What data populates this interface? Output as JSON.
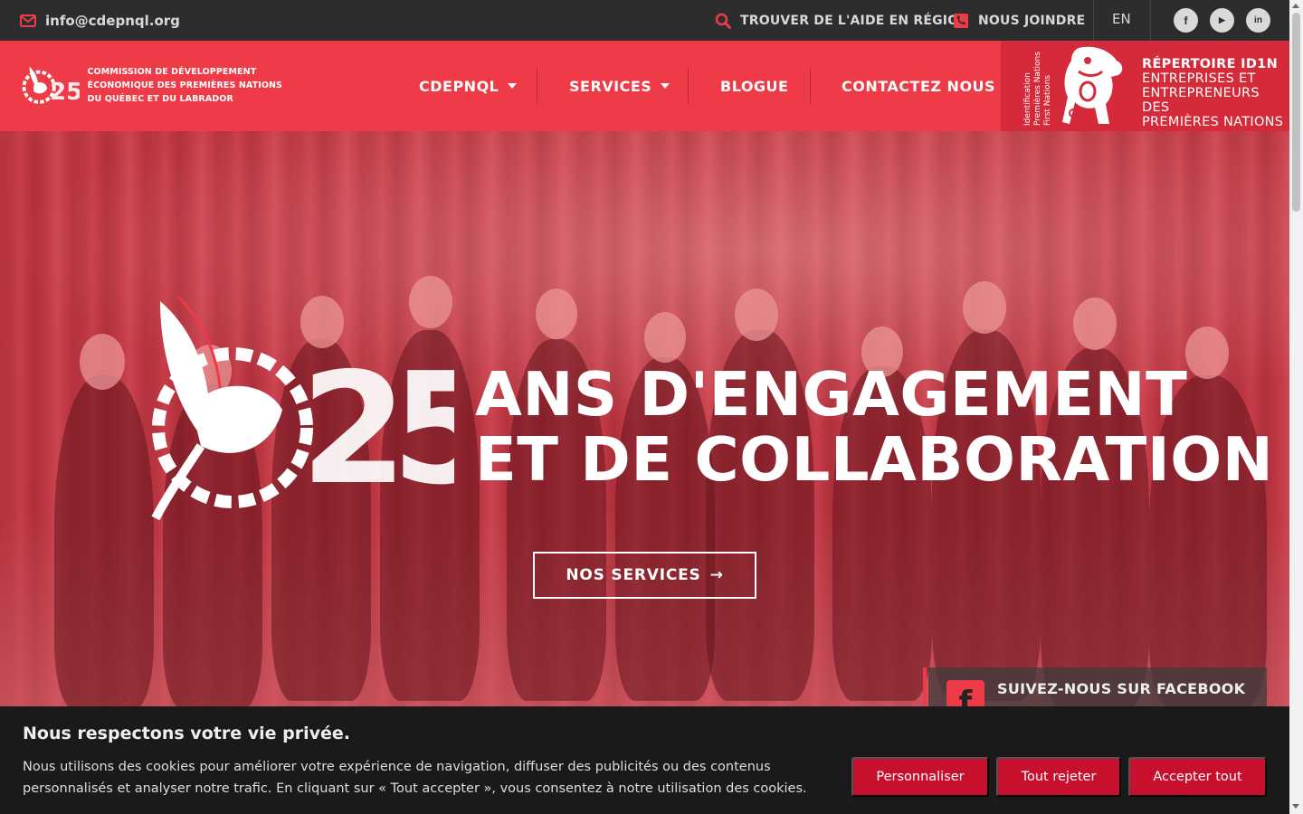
{
  "topbar": {
    "email": "info@cdepnql.org",
    "help_link": "TROUVER DE L'AIDE EN RÉGION",
    "join_link": "NOUS JOINDRE",
    "language": "EN",
    "social": [
      {
        "icon": "facebook-icon",
        "glyph": "f"
      },
      {
        "icon": "youtube-icon",
        "glyph": "▶"
      },
      {
        "icon": "linkedin-icon",
        "glyph": "in"
      }
    ]
  },
  "header": {
    "logo_lines": [
      "COMMISSION DE DÉVELOPPEMENT",
      "ÉCONOMIQUE DES PREMIÈRES NATIONS",
      "DU QUÉBEC ET DU LABRADOR"
    ],
    "nav": [
      {
        "label": "CDEPNQL",
        "dropdown": true
      },
      {
        "label": "SERVICES",
        "dropdown": true
      },
      {
        "label": "BLOGUE",
        "dropdown": false
      },
      {
        "label": "CONTACTEZ NOUS",
        "dropdown": false
      }
    ],
    "id1n": {
      "vertical_lines": [
        "Identification",
        "Premières Nations",
        "First Nations"
      ],
      "title": "RÉPERTOIRE ID1N",
      "subtitle_lines": [
        "ENTREPRISES ET",
        "ENTREPRENEURS DES",
        "PREMIÈRES NATIONS"
      ]
    }
  },
  "hero": {
    "headline_line1": "ANS D'ENGAGEMENT",
    "headline_line2": "ET DE COLLABORATION",
    "anniversary_number": "25",
    "cta_label": "NOS SERVICES",
    "facebook_label": "SUIVEZ-NOUS SUR FACEBOOK"
  },
  "cookie": {
    "title": "Nous respectons votre vie privée.",
    "text": "Nous utilisons des cookies pour améliorer votre expérience de navigation, diffuser des publicités ou des contenus personnalisés et analyser notre trafic. En cliquant sur « Tout accepter », vous consentez à notre utilisation des cookies.",
    "buttons": {
      "customize": "Personnaliser",
      "reject": "Tout rejeter",
      "accept": "Accepter tout"
    }
  },
  "colors": {
    "brand_red": "#ef3a47",
    "dark_red": "#d42a39",
    "topbar": "#2d2d30",
    "cookie_bg": "#1a1a1a",
    "cookie_button": "#c8102e"
  }
}
